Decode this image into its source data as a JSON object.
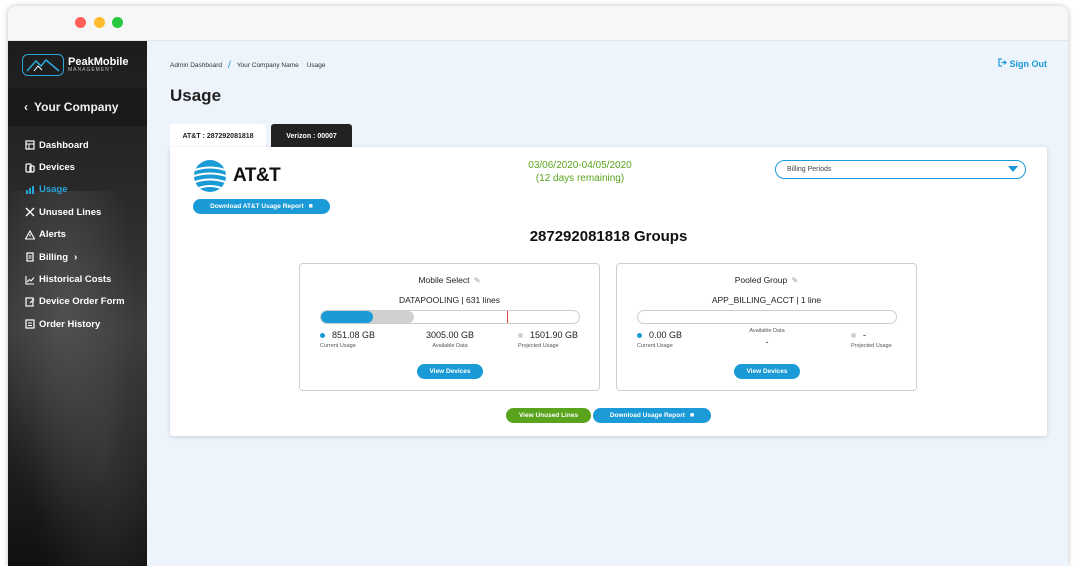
{
  "sidebar": {
    "logo_name": "PeakMobile",
    "logo_sub": "MANAGEMENT",
    "company": "Your Company",
    "items": [
      {
        "label": "Dashboard",
        "icon": "dashboard-icon"
      },
      {
        "label": "Devices",
        "icon": "devices-icon"
      },
      {
        "label": "Usage",
        "icon": "usage-icon",
        "active": true
      },
      {
        "label": "Unused Lines",
        "icon": "unused-lines-icon"
      },
      {
        "label": "Alerts",
        "icon": "alert-icon"
      },
      {
        "label": "Billing",
        "icon": "billing-icon"
      },
      {
        "label": "Historical Costs",
        "icon": "chart-icon"
      },
      {
        "label": "Device Order Form",
        "icon": "order-form-icon"
      },
      {
        "label": "Order History",
        "icon": "history-icon"
      }
    ]
  },
  "header": {
    "breadcrumb": [
      "Admin Dashboard",
      "Your Company Name",
      "Usage"
    ],
    "sign_out": "Sign Out",
    "title": "Usage"
  },
  "tabs": [
    "AT&T : 287292081818",
    "Verizon : 00007"
  ],
  "carrier": {
    "name": "AT&T",
    "download_label": "Download AT&T Usage Report",
    "period": "03/06/2020-04/05/2020",
    "remaining": "(12 days remaining)",
    "billing_placeholder": "Billing Periods",
    "groups_title": "287292081818 Groups"
  },
  "groups": [
    {
      "name": "Mobile Select",
      "account": "DATAPOOLING | 631 lines",
      "current_usage": "851.08 GB",
      "current_label": "Current Usage",
      "available": "3005.00 GB",
      "available_label": "Available Data",
      "projected": "1501.90 GB",
      "projected_label": "Projected Usage",
      "used_fraction": 0.2,
      "projected_fraction": 0.36,
      "limit_fraction": 0.72,
      "button": "View Devices"
    },
    {
      "name": "Pooled Group",
      "account": "APP_BILLING_ACCT | 1 line",
      "current_usage": "0.00 GB",
      "current_label": "Current Usage",
      "available": "-",
      "available_label": "Available Data",
      "projected": "-",
      "projected_label": "Projected Usage",
      "used_fraction": 0,
      "projected_fraction": 0,
      "button": "View Devices"
    }
  ],
  "footer_buttons": {
    "unused": "View Unused Lines",
    "download": "Download Usage Report"
  },
  "colors": {
    "accent": "#1a9ad6",
    "green": "#5aa31d",
    "limit_marker": "#e04040"
  }
}
